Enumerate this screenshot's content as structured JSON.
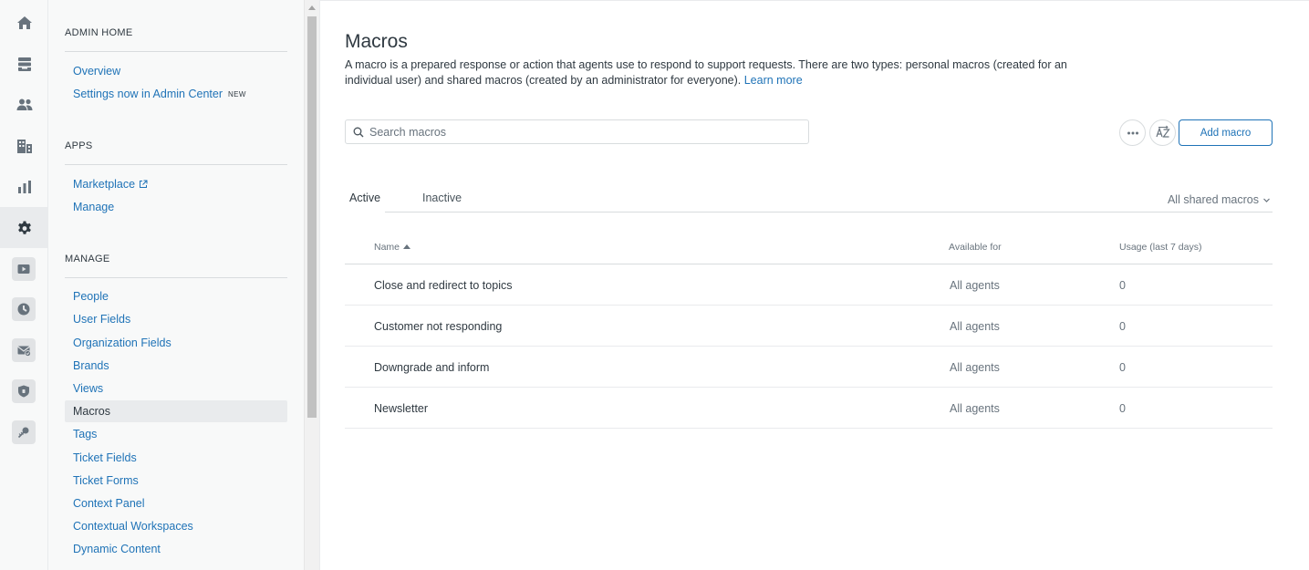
{
  "rail": {
    "items": [
      {
        "icon": "home-icon"
      },
      {
        "icon": "views-icon"
      },
      {
        "icon": "customers-icon"
      },
      {
        "icon": "organizations-icon"
      },
      {
        "icon": "reporting-icon"
      },
      {
        "icon": "admin-gear-icon",
        "active": true
      }
    ],
    "apps": [
      {
        "icon": "play-icon"
      },
      {
        "icon": "clock-app-icon"
      },
      {
        "icon": "mail-check-icon"
      },
      {
        "icon": "shield-app-icon"
      },
      {
        "icon": "pin-app-icon"
      }
    ]
  },
  "nav": {
    "admin_home": {
      "title": "ADMIN HOME",
      "links": [
        {
          "label": "Overview"
        },
        {
          "label": "Settings now in Admin Center",
          "badge": "NEW"
        }
      ]
    },
    "apps": {
      "title": "APPS",
      "links": [
        {
          "label": "Marketplace",
          "external": true
        },
        {
          "label": "Manage"
        }
      ]
    },
    "manage": {
      "title": "MANAGE",
      "links": [
        {
          "label": "People"
        },
        {
          "label": "User Fields"
        },
        {
          "label": "Organization Fields"
        },
        {
          "label": "Brands"
        },
        {
          "label": "Views"
        },
        {
          "label": "Macros",
          "selected": true
        },
        {
          "label": "Tags"
        },
        {
          "label": "Ticket Fields"
        },
        {
          "label": "Ticket Forms"
        },
        {
          "label": "Context Panel"
        },
        {
          "label": "Contextual Workspaces"
        },
        {
          "label": "Dynamic Content"
        }
      ]
    }
  },
  "main": {
    "title": "Macros",
    "description": "A macro is a prepared response or action that agents use to respond to support requests. There are two types: personal macros (created for an individual user) and shared macros (created by an administrator for everyone).",
    "learn_more": "Learn more",
    "search": {
      "placeholder": "Search macros",
      "value": ""
    },
    "actions": {
      "more_icon": "ellipsis-icon",
      "sort_icon": "sort-az-icon",
      "add_label": "Add macro"
    },
    "tabs": [
      {
        "label": "Active",
        "active": true
      },
      {
        "label": "Inactive",
        "active": false
      }
    ],
    "filter": {
      "label": "All shared macros"
    },
    "table": {
      "columns": [
        "Name",
        "Available for",
        "Usage (last 7 days)"
      ],
      "rows": [
        {
          "name": "Close and redirect to topics",
          "available": "All agents",
          "usage": "0"
        },
        {
          "name": "Customer not responding",
          "available": "All agents",
          "usage": "0"
        },
        {
          "name": "Downgrade and inform",
          "available": "All agents",
          "usage": "0"
        },
        {
          "name": "Newsletter",
          "available": "All agents",
          "usage": "0"
        }
      ]
    }
  },
  "colors": {
    "link": "#1f73b7",
    "text": "#2f3941",
    "muted": "#68737d",
    "rail_icon": "#68737d",
    "sidebar_bg": "#f8f9f9"
  }
}
